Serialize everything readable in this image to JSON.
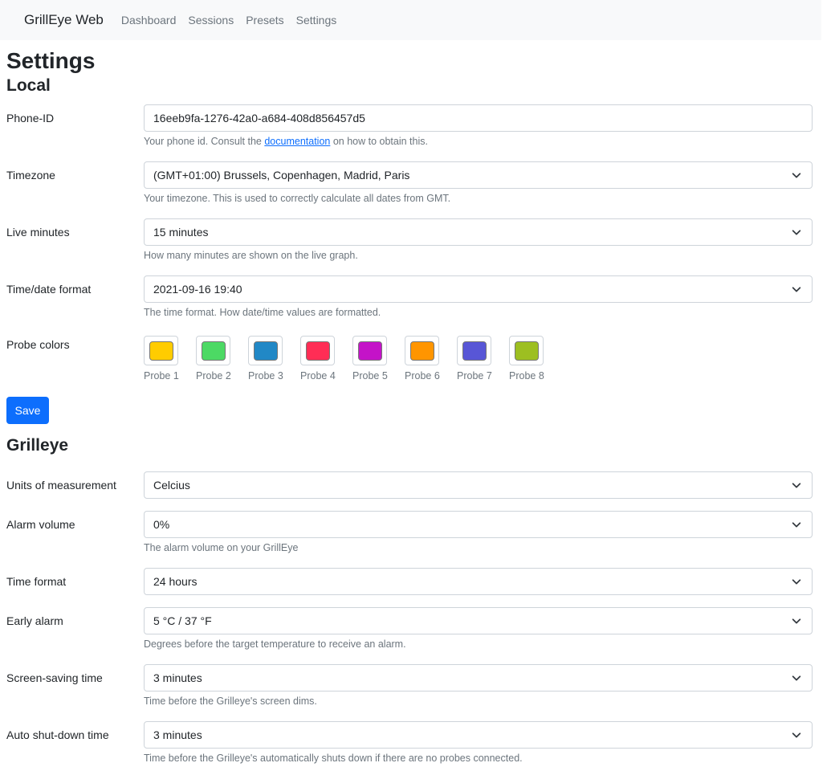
{
  "navbar": {
    "brand": "GrillEye Web",
    "links": [
      "Dashboard",
      "Sessions",
      "Presets",
      "Settings"
    ]
  },
  "page_title": "Settings",
  "local": {
    "heading": "Local",
    "phone_id": {
      "label": "Phone-ID",
      "value": "16eeb9fa-1276-42a0-a684-408d856457d5",
      "help_before": "Your phone id. Consult the ",
      "help_link": "documentation",
      "help_after": " on how to obtain this."
    },
    "timezone": {
      "label": "Timezone",
      "value": "(GMT+01:00) Brussels, Copenhagen, Madrid, Paris",
      "help": "Your timezone. This is used to correctly calculate all dates from GMT."
    },
    "live_minutes": {
      "label": "Live minutes",
      "value": "15 minutes",
      "help": "How many minutes are shown on the live graph."
    },
    "time_date_format": {
      "label": "Time/date format",
      "value": "2021-09-16 19:40",
      "help": "The time format. How date/time values are formatted."
    },
    "probe_colors": {
      "label": "Probe colors",
      "probes": [
        {
          "label": "Probe 1",
          "color": "#ffcc00"
        },
        {
          "label": "Probe 2",
          "color": "#4cd964"
        },
        {
          "label": "Probe 3",
          "color": "#2188c6"
        },
        {
          "label": "Probe 4",
          "color": "#ff2d55"
        },
        {
          "label": "Probe 5",
          "color": "#c413c8"
        },
        {
          "label": "Probe 6",
          "color": "#ff9500"
        },
        {
          "label": "Probe 7",
          "color": "#5856d6"
        },
        {
          "label": "Probe 8",
          "color": "#9dbf21"
        }
      ]
    },
    "save_label": "Save"
  },
  "grilleye": {
    "heading": "Grilleye",
    "units": {
      "label": "Units of measurement",
      "value": "Celcius"
    },
    "alarm_volume": {
      "label": "Alarm volume",
      "value": "0%",
      "help": "The alarm volume on your GrillEye"
    },
    "time_format": {
      "label": "Time format",
      "value": "24 hours"
    },
    "early_alarm": {
      "label": "Early alarm",
      "value": "5 °C / 37 °F",
      "help": "Degrees before the target temperature to receive an alarm."
    },
    "screen_saving": {
      "label": "Screen-saving time",
      "value": "3 minutes",
      "help": "Time before the Grilleye's screen dims."
    },
    "auto_shutdown": {
      "label": "Auto shut-down time",
      "value": "3 minutes",
      "help": "Time before the Grilleye's automatically shuts down if there are no probes connected."
    }
  },
  "colors": {
    "primary": "#0d6efd",
    "navbar_bg": "#f8f9fa",
    "muted": "#6c757d"
  }
}
